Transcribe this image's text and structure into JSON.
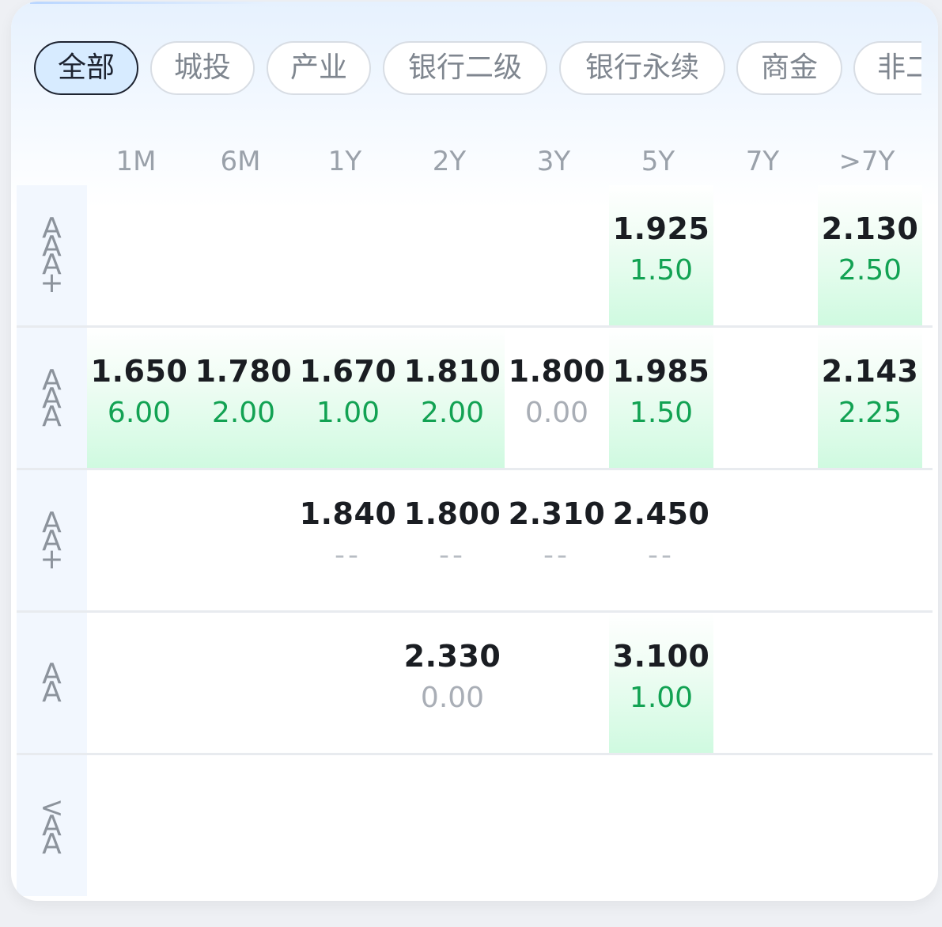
{
  "tabs": [
    {
      "label": "全部",
      "active": true
    },
    {
      "label": "城投"
    },
    {
      "label": "产业"
    },
    {
      "label": "银行二级"
    },
    {
      "label": "银行永续"
    },
    {
      "label": "商金"
    },
    {
      "label": "非二"
    }
  ],
  "columns": [
    "1M",
    "6M",
    "1Y",
    "2Y",
    "3Y",
    "5Y",
    "7Y",
    ">7Y"
  ],
  "rows": [
    {
      "label": "AAA+",
      "cells": [
        null,
        null,
        null,
        null,
        null,
        {
          "yield": "1.925",
          "volume": "1.50",
          "highlight": true
        },
        null,
        {
          "yield": "2.130",
          "volume": "2.50",
          "highlight": true
        }
      ]
    },
    {
      "label": "AAA",
      "cells": [
        {
          "yield": "1.650",
          "volume": "6.00",
          "highlight": true
        },
        {
          "yield": "1.780",
          "volume": "2.00",
          "highlight": true
        },
        {
          "yield": "1.670",
          "volume": "1.00",
          "highlight": true
        },
        {
          "yield": "1.810",
          "volume": "2.00",
          "highlight": true
        },
        {
          "yield": "1.800",
          "volume": "0.00",
          "highlight": false
        },
        {
          "yield": "1.985",
          "volume": "1.50",
          "highlight": true
        },
        null,
        {
          "yield": "2.143",
          "volume": "2.25",
          "highlight": true
        }
      ]
    },
    {
      "label": "AA+",
      "cells": [
        null,
        null,
        {
          "yield": "1.840",
          "volume": "--",
          "highlight": false
        },
        {
          "yield": "1.800",
          "volume": "--",
          "highlight": false
        },
        {
          "yield": "2.310",
          "volume": "--",
          "highlight": false
        },
        {
          "yield": "2.450",
          "volume": "--",
          "highlight": false
        },
        null,
        null
      ]
    },
    {
      "label": "AA",
      "cells": [
        null,
        null,
        null,
        {
          "yield": "2.330",
          "volume": "0.00",
          "highlight": false
        },
        null,
        {
          "yield": "3.100",
          "volume": "1.00",
          "highlight": true
        },
        null,
        null
      ]
    },
    {
      "label": "<AA",
      "cells": [
        null,
        null,
        null,
        null,
        null,
        null,
        null,
        null
      ]
    }
  ],
  "colors": {
    "accent_tab_bg": "#d7ebff",
    "volume_positive": "#12a253",
    "volume_zero": "#a9aeb6",
    "highlight_cell": "#cffae0"
  }
}
